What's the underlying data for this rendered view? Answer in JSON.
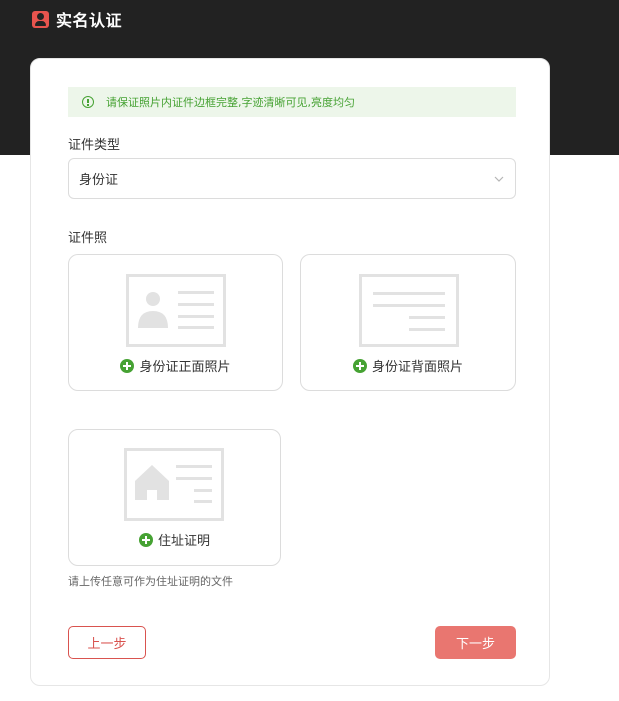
{
  "header": {
    "title": "实名认证",
    "icon": "id-card-icon"
  },
  "notice": {
    "icon": "info-circle-icon",
    "text": "请保证照片内证件边框完整,字迹清晰可见,亮度均匀"
  },
  "form": {
    "doc_type_label": "证件类型",
    "doc_type_value": "身份证",
    "doc_photo_label": "证件照"
  },
  "uploads": {
    "front": {
      "label": "身份证正面照片"
    },
    "back": {
      "label": "身份证背面照片"
    },
    "address": {
      "label": "住址证明"
    }
  },
  "hint": "请上传任意可作为住址证明的文件",
  "buttons": {
    "prev": "上一步",
    "next": "下一步"
  },
  "colors": {
    "accent_red": "#e97670",
    "success_green": "#46a233",
    "header_bg": "#222222"
  }
}
